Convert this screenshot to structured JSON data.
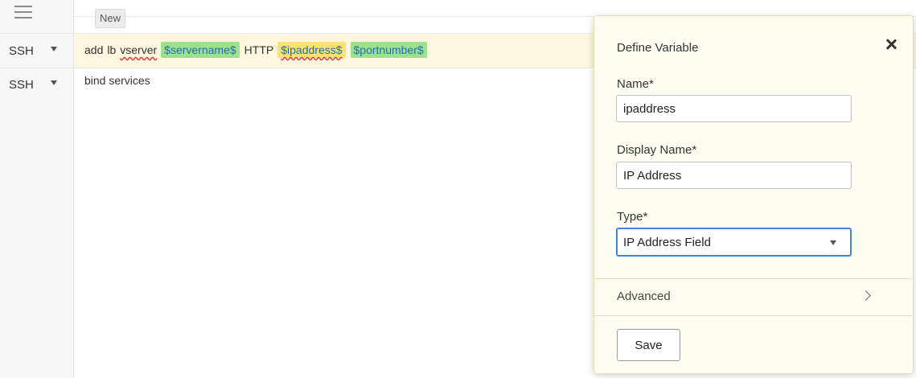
{
  "toolbar": {
    "new_label": "New"
  },
  "rows": [
    {
      "lang": "SSH"
    },
    {
      "lang": "SSH"
    }
  ],
  "commands": {
    "line1": {
      "t1": "add",
      "t2": "lb",
      "t3": "vserver",
      "var1": "$servername$",
      "t4": "HTTP",
      "var2": "$ipaddress$",
      "var3": "$portnumber$"
    },
    "line2": "bind services"
  },
  "panel": {
    "title": "Define Variable",
    "name_label": "Name*",
    "name_value": "ipaddress",
    "display_name_label": "Display Name*",
    "display_name_value": "IP Address",
    "type_label": "Type*",
    "type_value": "IP Address Field",
    "advanced_label": "Advanced",
    "save_label": "Save"
  },
  "colors": {
    "var_green": "#9de08e",
    "var_yellow": "#fde36a",
    "select_focus": "#3f86d8",
    "panel_bg": "#fffdf2"
  }
}
